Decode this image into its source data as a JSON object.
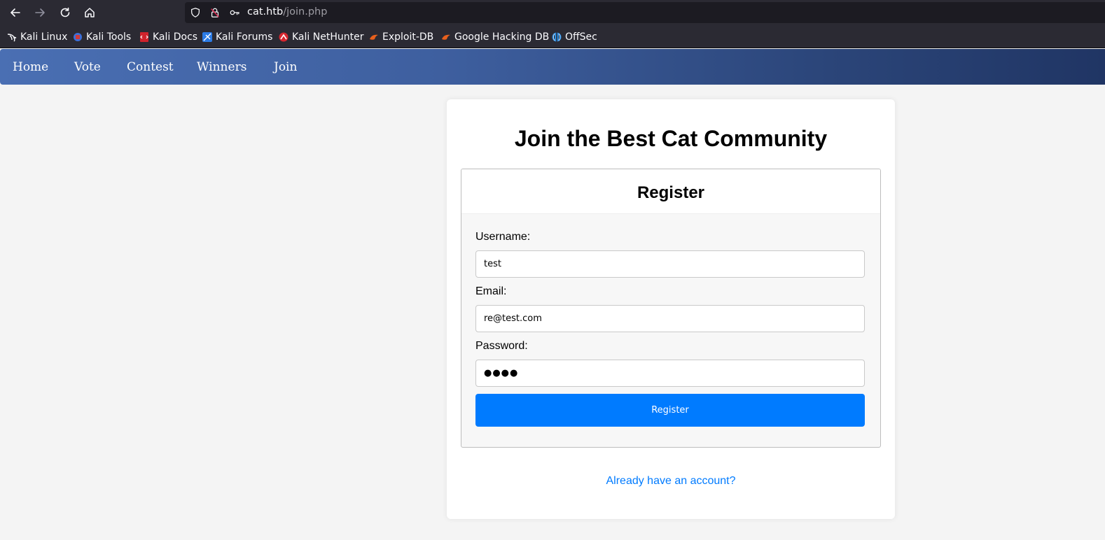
{
  "browser": {
    "url_host": "cat.htb",
    "url_path": "/join.php",
    "bookmarks": [
      {
        "label": "Kali Linux",
        "icon": "kali-dragon-icon"
      },
      {
        "label": "Kali Tools",
        "icon": "kali-tools-icon"
      },
      {
        "label": "Kali Docs",
        "icon": "kali-docs-icon"
      },
      {
        "label": "Kali Forums",
        "icon": "kali-forums-icon"
      },
      {
        "label": "Kali NetHunter",
        "icon": "kali-nethunter-icon"
      },
      {
        "label": "Exploit-DB",
        "icon": "exploit-db-icon"
      },
      {
        "label": "Google Hacking DB",
        "icon": "ghdb-icon"
      },
      {
        "label": "OffSec",
        "icon": "offsec-icon"
      }
    ]
  },
  "nav": {
    "items": [
      {
        "label": "Home"
      },
      {
        "label": "Vote"
      },
      {
        "label": "Contest"
      },
      {
        "label": "Winners"
      },
      {
        "label": "Join"
      }
    ]
  },
  "page": {
    "title": "Join the Best Cat Community"
  },
  "form": {
    "heading": "Register",
    "username_label": "Username:",
    "username_value": "test",
    "email_label": "Email:",
    "email_value": "re@test.com",
    "password_label": "Password:",
    "password_value": "●●●●",
    "submit_label": "Register"
  },
  "login_link": "Already have an account?",
  "colors": {
    "accent": "#007bff",
    "nav_start": "#4a6fb3",
    "nav_end": "#203564"
  }
}
